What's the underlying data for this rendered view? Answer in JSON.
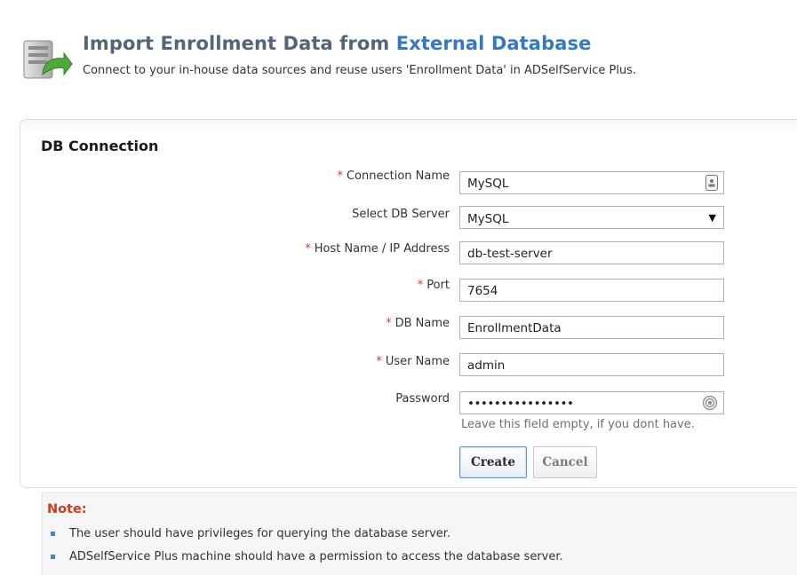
{
  "header": {
    "title_part1": "Import Enrollment Data from ",
    "title_part2": "External Database",
    "subtitle": "Connect to your in-house data sources and reuse users 'Enrollment Data' in ADSelfService Plus.",
    "icon": "database-import-icon"
  },
  "form": {
    "section_title": "DB Connection",
    "required_marker": "*",
    "connection_name": {
      "label": "Connection Name",
      "value": "MySQL",
      "icon": "contact-card-icon"
    },
    "db_server": {
      "label": "Select DB Server",
      "value": "MySQL",
      "icon": "chevron-down-icon"
    },
    "host": {
      "label": "Host Name / IP Address",
      "value": "db-test-server"
    },
    "port": {
      "label": "Port",
      "value": "7654"
    },
    "db_name": {
      "label": "DB Name",
      "value": "EnrollmentData"
    },
    "user_name": {
      "label": "User Name",
      "value": "admin"
    },
    "password": {
      "label": "Password",
      "value": "••••••••••••••••",
      "hint": "Leave this field empty, if you dont have.",
      "icon": "show-password-icon"
    },
    "create_label": "Create",
    "cancel_label": "Cancel"
  },
  "note": {
    "title": "Note:",
    "items": [
      "The user should have privileges for querying the database server.",
      "ADSelfService Plus machine should have a permission to access the database server."
    ]
  },
  "colors": {
    "title": "#54647a",
    "title_accent": "#3579c4",
    "required": "#e0392b",
    "note_title": "#d0391c",
    "bullet": "#3a87d1"
  }
}
